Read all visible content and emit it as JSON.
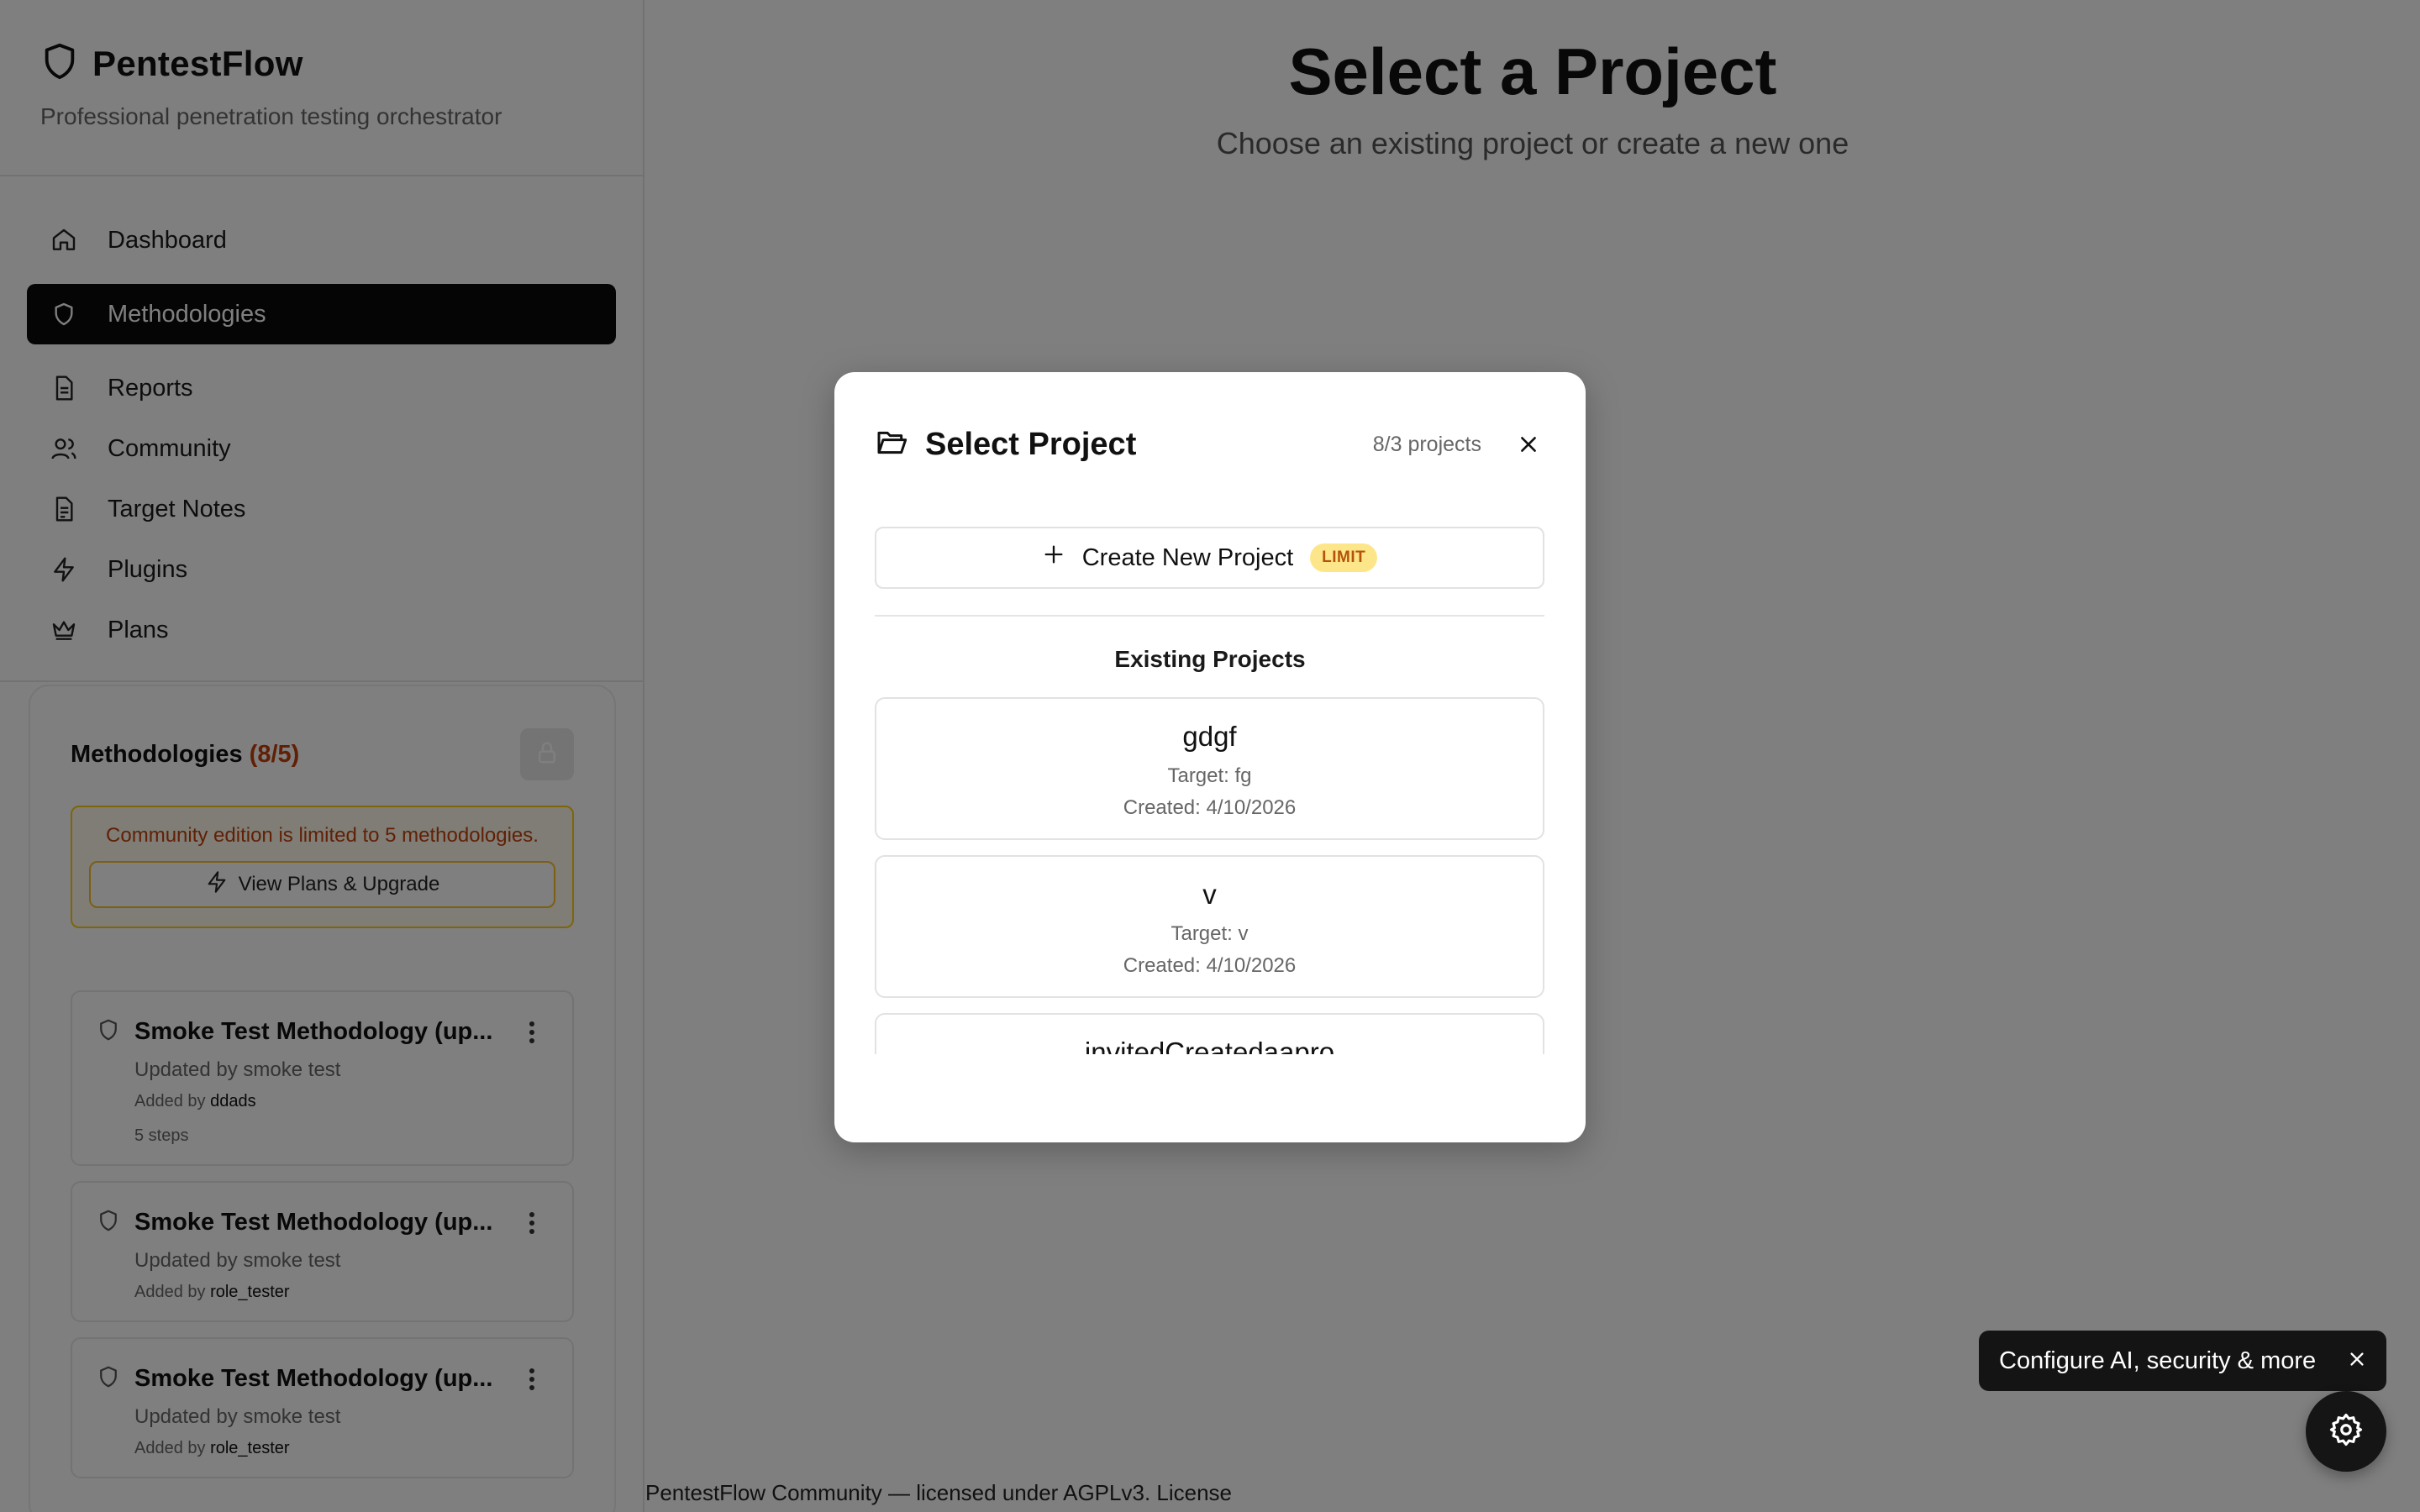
{
  "app": {
    "name": "PentestFlow",
    "tagline": "Professional penetration testing orchestrator"
  },
  "nav": [
    {
      "label": "Dashboard",
      "icon": "home-icon"
    },
    {
      "label": "Methodologies",
      "icon": "shield-icon",
      "active": true
    },
    {
      "label": "Reports",
      "icon": "document-icon"
    },
    {
      "label": "Community",
      "icon": "users-icon"
    },
    {
      "label": "Target Notes",
      "icon": "notes-icon"
    },
    {
      "label": "Plugins",
      "icon": "bolt-icon"
    },
    {
      "label": "Plans",
      "icon": "crown-icon"
    }
  ],
  "methodologies": {
    "title": "Methodologies",
    "count": "(8/5)",
    "limit_text": "Community edition is limited to 5 methodologies.",
    "upgrade_label": "View Plans & Upgrade",
    "cards": [
      {
        "title": "Smoke Test Methodology (up...",
        "subtitle": "Updated by smoke test",
        "added_prefix": "Added by",
        "added_by": "ddads",
        "steps": "5 steps"
      },
      {
        "title": "Smoke Test Methodology (up...",
        "subtitle": "Updated by smoke test",
        "added_prefix": "Added by",
        "added_by": "role_tester"
      },
      {
        "title": "Smoke Test Methodology (up...",
        "subtitle": "Updated by smoke test",
        "added_prefix": "Added by",
        "added_by": "role_tester"
      }
    ]
  },
  "main": {
    "title": "Select a Project",
    "subtitle": "Choose an existing project or create a new one"
  },
  "footer": {
    "text": "PentestFlow Community — licensed under AGPLv3. License"
  },
  "modal": {
    "title": "Select Project",
    "count": "8/3 projects",
    "create_label": "Create New Project",
    "limit_badge": "LIMIT",
    "section_title": "Existing Projects",
    "projects": [
      {
        "name": "gdgf",
        "target": "Target: fg",
        "created": "Created: 4/10/2026"
      },
      {
        "name": "v",
        "target": "Target: v",
        "created": "Created: 4/10/2026"
      },
      {
        "name": "invitedCreatedaapro",
        "target": "",
        "created": ""
      }
    ]
  },
  "toast": {
    "text": "Configure AI, security & more"
  },
  "colors": {
    "accent_dark": "#0b0b0b",
    "warning": "#c2410c",
    "warning_border": "#facc15",
    "badge_bg": "#fde68a"
  }
}
